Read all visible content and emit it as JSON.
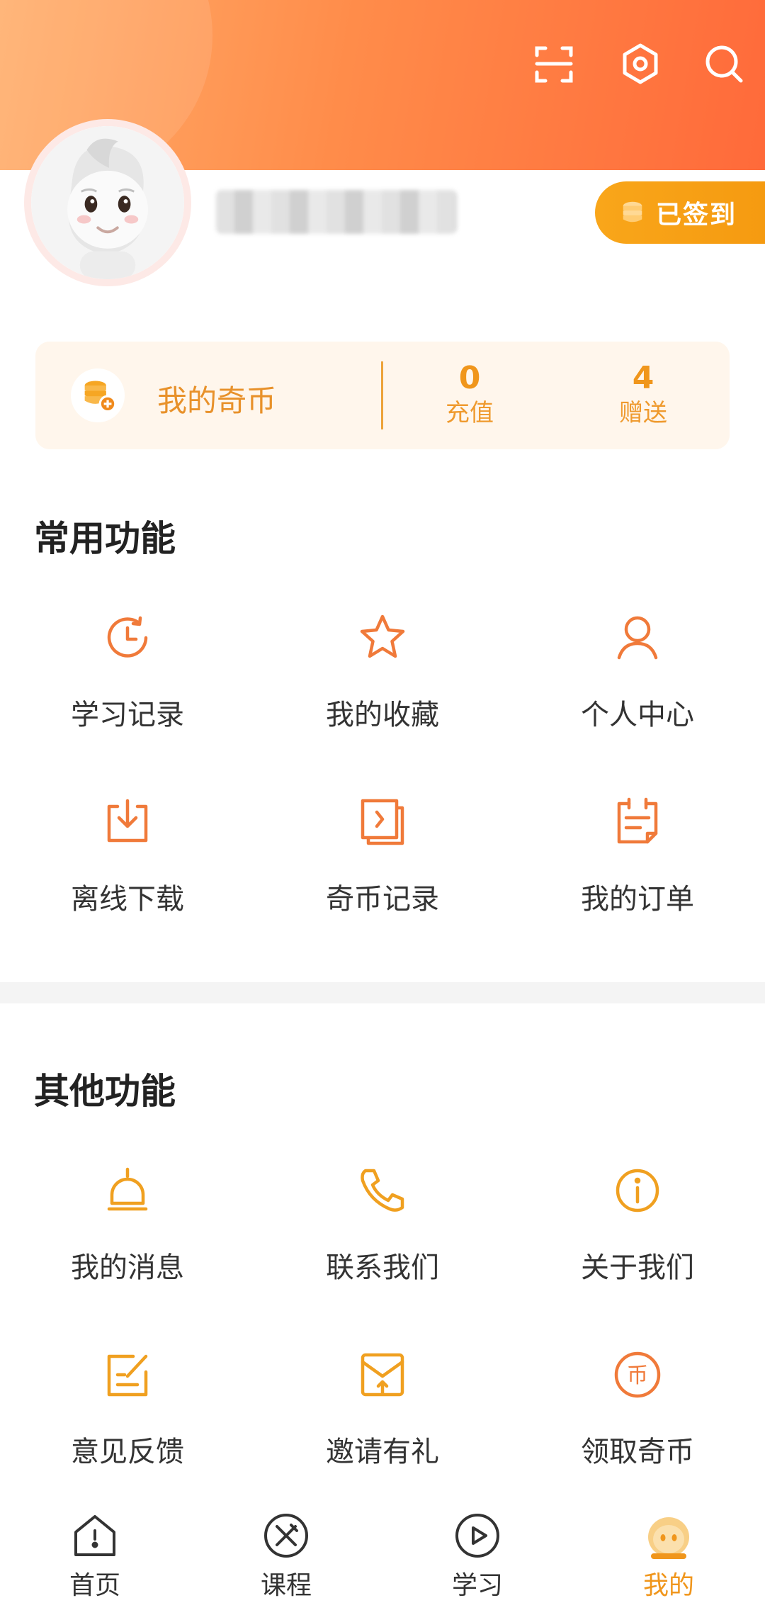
{
  "header": {
    "icons": [
      "scan-icon",
      "settings-hexagon-icon",
      "search-icon"
    ],
    "accent_color": "#ff8c4a"
  },
  "profile": {
    "signin_label": "已签到"
  },
  "coins": {
    "title": "我的奇币",
    "recharge_value": "0",
    "recharge_label": "充值",
    "gift_value": "4",
    "gift_label": "赠送"
  },
  "common": {
    "title": "常用功能",
    "items": [
      {
        "label": "学习记录",
        "icon": "history-clock-icon"
      },
      {
        "label": "我的收藏",
        "icon": "star-icon"
      },
      {
        "label": "个人中心",
        "icon": "user-icon"
      },
      {
        "label": "离线下载",
        "icon": "download-icon"
      },
      {
        "label": "奇币记录",
        "icon": "coin-record-icon"
      },
      {
        "label": "我的订单",
        "icon": "order-icon"
      }
    ]
  },
  "other": {
    "title": "其他功能",
    "items": [
      {
        "label": "我的消息",
        "icon": "bell-icon"
      },
      {
        "label": "联系我们",
        "icon": "phone-icon"
      },
      {
        "label": "关于我们",
        "icon": "info-icon"
      },
      {
        "label": "意见反馈",
        "icon": "feedback-icon"
      },
      {
        "label": "邀请有礼",
        "icon": "invite-envelope-icon"
      },
      {
        "label": "领取奇币",
        "icon": "coin-icon"
      }
    ]
  },
  "tabs": [
    {
      "label": "首页",
      "icon": "home-icon"
    },
    {
      "label": "课程",
      "icon": "course-icon"
    },
    {
      "label": "学习",
      "icon": "play-icon"
    },
    {
      "label": "我的",
      "icon": "mine-icon",
      "active": true
    }
  ]
}
